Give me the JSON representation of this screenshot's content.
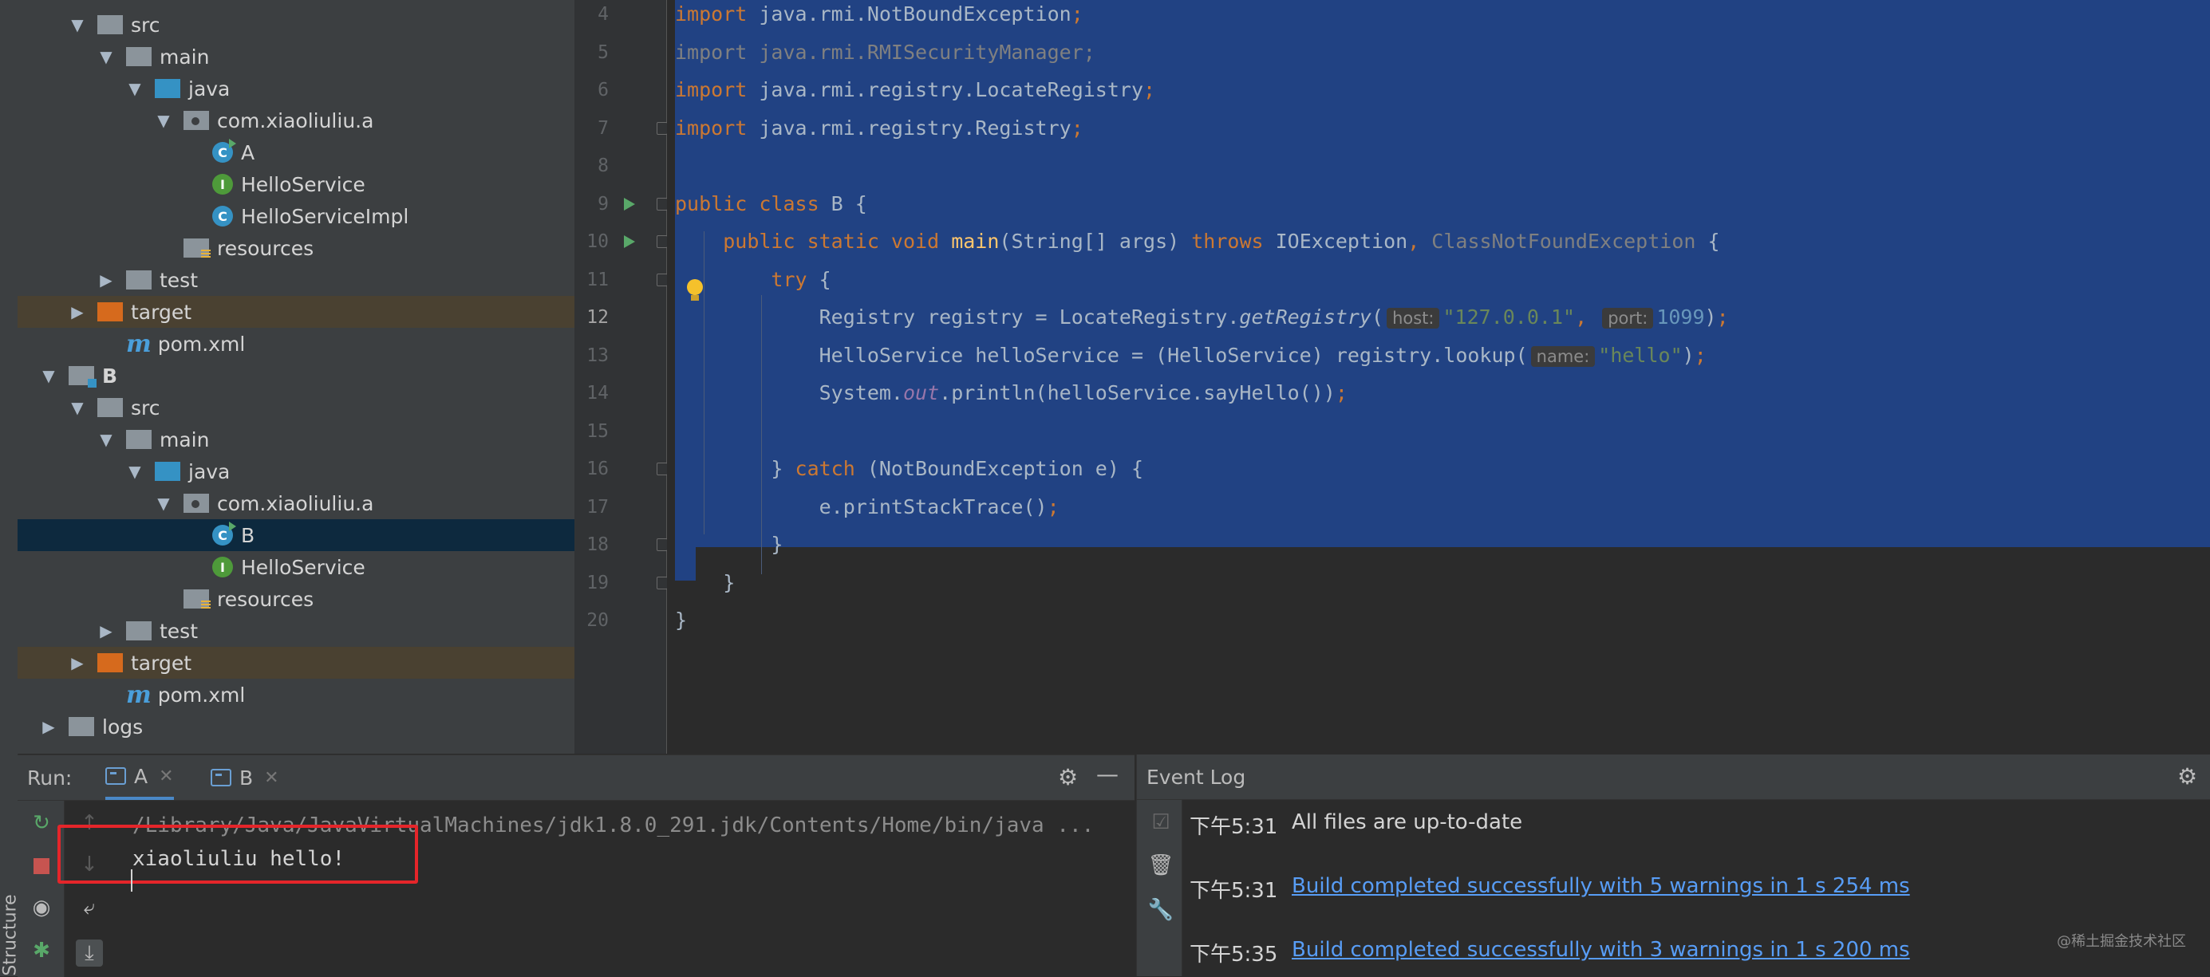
{
  "project_tree": {
    "rows": [
      {
        "label": "src",
        "depth": 1,
        "icon": "folder-gray",
        "arrow": "down"
      },
      {
        "label": "main",
        "depth": 2,
        "icon": "folder-gray",
        "arrow": "down"
      },
      {
        "label": "java",
        "depth": 3,
        "icon": "folder-blue",
        "arrow": "down"
      },
      {
        "label": "com.xiaoliuliu.a",
        "depth": 4,
        "icon": "package",
        "arrow": "down"
      },
      {
        "label": "A",
        "depth": 5,
        "icon": "class-run"
      },
      {
        "label": "HelloService",
        "depth": 5,
        "icon": "interface"
      },
      {
        "label": "HelloServiceImpl",
        "depth": 5,
        "icon": "class"
      },
      {
        "label": "resources",
        "depth": 4,
        "icon": "resources"
      },
      {
        "label": "test",
        "depth": 2,
        "icon": "folder-gray",
        "arrow": "right"
      },
      {
        "label": "target",
        "depth": 1,
        "icon": "folder-orange",
        "arrow": "right",
        "highlight": "target"
      },
      {
        "label": "pom.xml",
        "depth": 2,
        "icon": "maven"
      },
      {
        "label": "B",
        "depth": 0,
        "icon": "module",
        "arrow": "down",
        "bold": true
      },
      {
        "label": "src",
        "depth": 1,
        "icon": "folder-gray",
        "arrow": "down"
      },
      {
        "label": "main",
        "depth": 2,
        "icon": "folder-gray",
        "arrow": "down"
      },
      {
        "label": "java",
        "depth": 3,
        "icon": "folder-blue",
        "arrow": "down"
      },
      {
        "label": "com.xiaoliuliu.a",
        "depth": 4,
        "icon": "package",
        "arrow": "down"
      },
      {
        "label": "B",
        "depth": 5,
        "icon": "class-run",
        "highlight": "selected"
      },
      {
        "label": "HelloService",
        "depth": 5,
        "icon": "interface"
      },
      {
        "label": "resources",
        "depth": 4,
        "icon": "resources"
      },
      {
        "label": "test",
        "depth": 2,
        "icon": "folder-gray",
        "arrow": "right"
      },
      {
        "label": "target",
        "depth": 1,
        "icon": "folder-orange",
        "arrow": "right",
        "highlight": "target"
      },
      {
        "label": "pom.xml",
        "depth": 2,
        "icon": "maven"
      },
      {
        "label": "logs",
        "depth": 0,
        "icon": "folder-gray",
        "arrow": "right"
      }
    ]
  },
  "editor": {
    "current_line": "12",
    "lines": [
      {
        "num": "4",
        "tokens": [
          {
            "t": "import ",
            "c": "kw"
          },
          {
            "t": "java.rmi.NotBoundException"
          },
          {
            "t": ";",
            "c": "kw"
          }
        ]
      },
      {
        "num": "5",
        "tokens": [
          {
            "t": "import java.rmi.RMISecurityManager;",
            "c": "dim"
          }
        ]
      },
      {
        "num": "6",
        "tokens": [
          {
            "t": "import ",
            "c": "kw"
          },
          {
            "t": "java.rmi.registry.LocateRegistry"
          },
          {
            "t": ";",
            "c": "kw"
          }
        ]
      },
      {
        "num": "7",
        "tokens": [
          {
            "t": "import ",
            "c": "kw"
          },
          {
            "t": "java.rmi.registry.Registry"
          },
          {
            "t": ";",
            "c": "kw"
          }
        ]
      },
      {
        "num": "8",
        "tokens": []
      },
      {
        "num": "9",
        "tokens": [
          {
            "t": "public class ",
            "c": "kw"
          },
          {
            "t": "B {"
          }
        ]
      },
      {
        "num": "10",
        "tokens": [
          {
            "t": "    "
          },
          {
            "t": "public static void ",
            "c": "kw"
          },
          {
            "t": "main",
            "c": "fn"
          },
          {
            "t": "(String[] args) "
          },
          {
            "t": "throws ",
            "c": "kw"
          },
          {
            "t": "IOException"
          },
          {
            "t": ", ",
            "c": "kw"
          },
          {
            "t": "ClassNotFoundException",
            "c": "dim"
          },
          {
            "t": " {"
          }
        ]
      },
      {
        "num": "11",
        "tokens": [
          {
            "t": "        "
          },
          {
            "t": "try ",
            "c": "kw"
          },
          {
            "t": "{"
          }
        ]
      },
      {
        "num": "12",
        "tokens": [
          {
            "t": "            Registry registry = LocateRegistry."
          },
          {
            "t": "getRegistry",
            "c": "it"
          },
          {
            "t": "("
          },
          {
            "hint": "host:"
          },
          {
            "t": "\"127.0.0.1\"",
            "c": "str"
          },
          {
            "t": ",",
            "c": "kw"
          },
          {
            "t": " "
          },
          {
            "hint": "port:"
          },
          {
            "t": "1099",
            "c": "num"
          },
          {
            "t": ")"
          },
          {
            "t": ";",
            "c": "kw"
          }
        ]
      },
      {
        "num": "13",
        "tokens": [
          {
            "t": "            HelloService helloService = (HelloService) registry.lookup("
          },
          {
            "hint": "name:"
          },
          {
            "t": "\"hello\"",
            "c": "str"
          },
          {
            "t": ")"
          },
          {
            "t": ";",
            "c": "kw"
          }
        ]
      },
      {
        "num": "14",
        "tokens": [
          {
            "t": "            System."
          },
          {
            "t": "out",
            "c": "stat"
          },
          {
            "t": ".println(helloService.sayHello())"
          },
          {
            "t": ";",
            "c": "kw"
          }
        ]
      },
      {
        "num": "15",
        "tokens": []
      },
      {
        "num": "16",
        "tokens": [
          {
            "t": "        } "
          },
          {
            "t": "catch ",
            "c": "kw"
          },
          {
            "t": "(NotBoundException e) {"
          }
        ]
      },
      {
        "num": "17",
        "tokens": [
          {
            "t": "            e.printStackTrace()"
          },
          {
            "t": ";",
            "c": "kw"
          }
        ]
      },
      {
        "num": "18",
        "tokens": [
          {
            "t": "        }"
          }
        ]
      },
      {
        "num": "19",
        "tokens": [
          {
            "t": "    }"
          }
        ]
      },
      {
        "num": "20",
        "tokens": [
          {
            "t": "}"
          }
        ]
      }
    ]
  },
  "run_panel": {
    "label": "Run:",
    "tabs": [
      {
        "label": "A",
        "active": true
      },
      {
        "label": "B",
        "active": false
      }
    ],
    "console_lines": [
      {
        "text": "/Library/Java/JavaVirtualMachines/jdk1.8.0_291.jdk/Contents/Home/bin/java ...",
        "color": "#8c8c8c"
      },
      {
        "text": "xiaoliuliu hello!",
        "color": "#d4d4d4"
      }
    ]
  },
  "event_log": {
    "title": "Event Log",
    "entries": [
      {
        "time": "下午5:31",
        "message": "All files are up-to-date",
        "link": false
      },
      {
        "time": "下午5:31",
        "message": "Build completed successfully with 5 warnings in 1 s 254 ms",
        "link": true
      },
      {
        "time": "下午5:35",
        "message": "Build completed successfully with 3 warnings in 1 s 200 ms",
        "link": true
      }
    ]
  },
  "side_strip": {
    "structure_label": "Structure"
  },
  "watermark": "@稀土掘金技术社区"
}
